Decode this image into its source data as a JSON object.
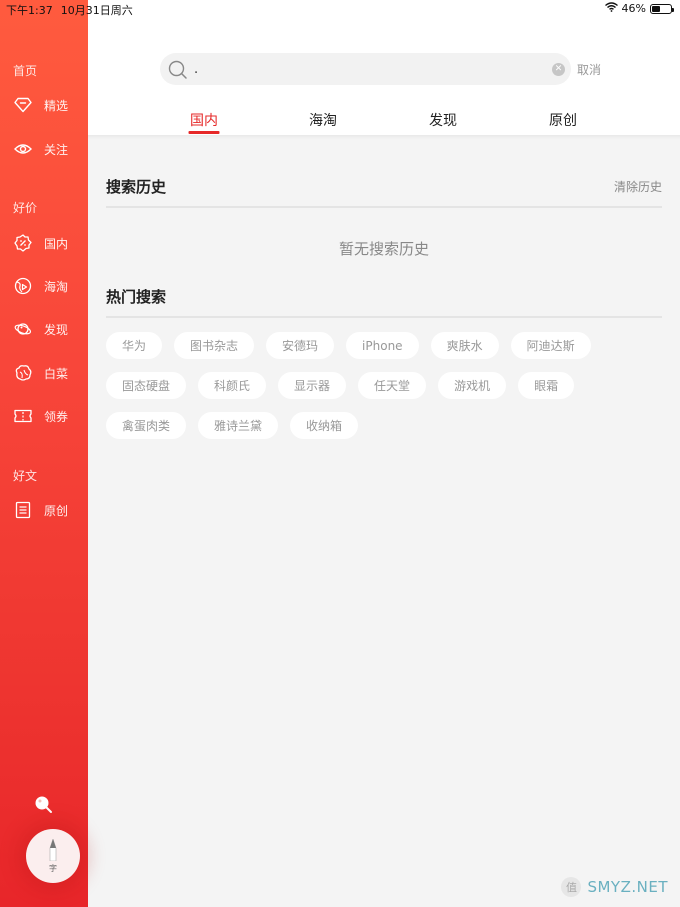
{
  "status_bar": {
    "time": "下午1:37",
    "date": "10月31日周六",
    "battery_percent": "46%",
    "battery_level": 0.46,
    "wifi_icon": "wifi-icon"
  },
  "sidebar": {
    "sections": [
      {
        "title": "首页",
        "items": [
          {
            "label": "精选",
            "icon": "diamond-icon"
          },
          {
            "label": "关注",
            "icon": "eye-icon"
          }
        ]
      },
      {
        "title": "好价",
        "items": [
          {
            "label": "国内",
            "icon": "discount-badge-icon"
          },
          {
            "label": "海淘",
            "icon": "globe-play-icon"
          },
          {
            "label": "发现",
            "icon": "planet-icon"
          },
          {
            "label": "白菜",
            "icon": "cabbage-icon"
          },
          {
            "label": "领券",
            "icon": "ticket-icon"
          }
        ]
      },
      {
        "title": "好文",
        "items": [
          {
            "label": "原创",
            "icon": "document-icon"
          }
        ]
      }
    ],
    "search_icon": "search-icon",
    "fab": {
      "label": "字",
      "icon": "pen-icon"
    }
  },
  "header": {
    "search": {
      "value": ".",
      "placeholder": ""
    },
    "cancel_label": "取消",
    "tabs": [
      {
        "label": "国内",
        "active": true
      },
      {
        "label": "海淘",
        "active": false
      },
      {
        "label": "发现",
        "active": false
      },
      {
        "label": "原创",
        "active": false
      }
    ]
  },
  "history": {
    "title": "搜索历史",
    "clear_label": "清除历史",
    "empty_text": "暂无搜索历史"
  },
  "hot": {
    "title": "热门搜索",
    "items": [
      "华为",
      "图书杂志",
      "安德玛",
      "iPhone",
      "爽肤水",
      "阿迪达斯",
      "固态硬盘",
      "科颜氏",
      "显示器",
      "任天堂",
      "游戏机",
      "眼霜",
      "禽蛋肉类",
      "雅诗兰黛",
      "收纳箱"
    ]
  },
  "watermark": {
    "badge": "值",
    "text": "SMYZ.NET"
  },
  "colors": {
    "accent": "#e62828",
    "sidebar_top": "#ff5b3e",
    "sidebar_bottom": "#e8262a"
  }
}
